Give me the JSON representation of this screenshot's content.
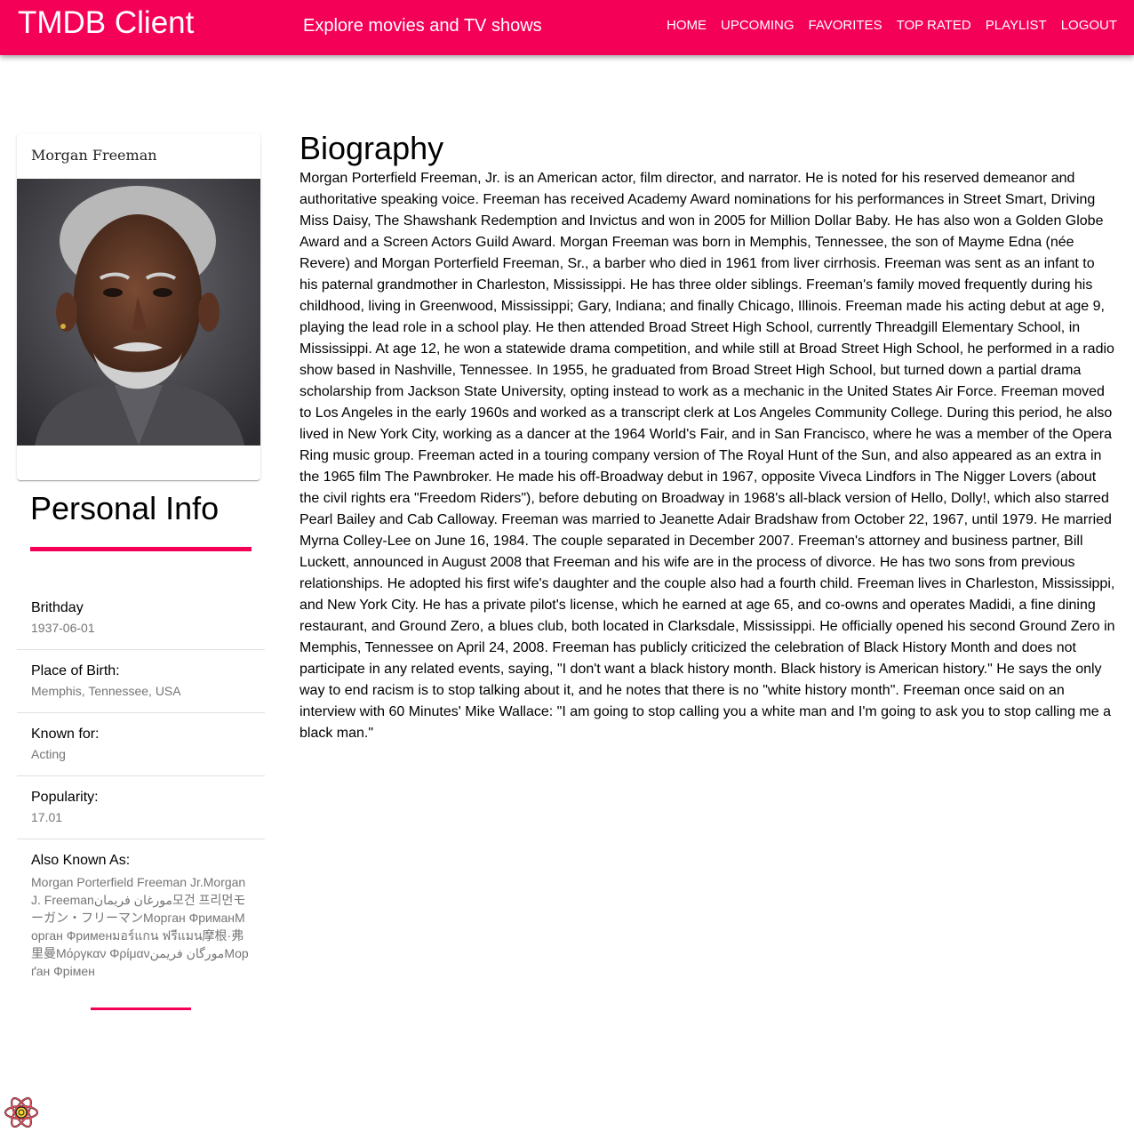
{
  "header": {
    "brand": "TMDB Client",
    "tagline": "Explore movies and TV shows",
    "nav": [
      "HOME",
      "UPCOMING",
      "FAVORITES",
      "TOP RATED",
      "PLAYLIST",
      "LOGOUT"
    ]
  },
  "person": {
    "name": "Morgan Freeman"
  },
  "personal_info": {
    "title": "Personal Info",
    "birthday_label": "Brithday",
    "birthday": "1937-06-01",
    "place_label": "Place of Birth:",
    "place": "Memphis, Tennessee, USA",
    "known_for_label": "Known for:",
    "known_for": "Acting",
    "popularity_label": "Popularity:",
    "popularity": "17.01",
    "aka_label": "Also Known As:",
    "aka": "Morgan Porterfield Freeman Jr.Morgan J. Freemanمورغان فريمان모건 프리먼モーガン・フリーマンМорган ФриманМорган Фрименมอร์แกน ฟรีแมน摩根·弗里曼Μόργκαν Φρίμανمورگان فریمنМорґан Фрімен"
  },
  "biography": {
    "title": "Biography",
    "text": "Morgan Porterfield Freeman, Jr. is an American actor, film director, and narrator. He is noted for his reserved demeanor and authoritative speaking voice. Freeman has received Academy Award nominations for his performances in Street Smart, Driving Miss Daisy, The Shawshank Redemption and Invictus and won in 2005 for Million Dollar Baby. He has also won a Golden Globe Award and a Screen Actors Guild Award. Morgan Freeman was born in Memphis, Tennessee, the son of Mayme Edna (née Revere) and Morgan Porterfield Freeman, Sr., a barber who died in 1961 from liver cirrhosis. Freeman was sent as an infant to his paternal grandmother in Charleston, Mississippi. He has three older siblings. Freeman's family moved frequently during his childhood, living in Greenwood, Mississippi; Gary, Indiana; and finally Chicago, Illinois. Freeman made his acting debut at age 9, playing the lead role in a school play. He then attended Broad Street High School, currently Threadgill Elementary School, in Mississippi. At age 12, he won a statewide drama competition, and while still at Broad Street High School, he performed in a radio show based in Nashville, Tennessee. In 1955, he graduated from Broad Street High School, but turned down a partial drama scholarship from Jackson State University, opting instead to work as a mechanic in the United States Air Force. Freeman moved to Los Angeles in the early 1960s and worked as a transcript clerk at Los Angeles Community College. During this period, he also lived in New York City, working as a dancer at the 1964 World's Fair, and in San Francisco, where he was a member of the Opera Ring music group. Freeman acted in a touring company version of The Royal Hunt of the Sun, and also appeared as an extra in the 1965 film The Pawnbroker. He made his off-Broadway debut in 1967, opposite Viveca Lindfors in The Nigger Lovers (about the civil rights era \"Freedom Riders\"), before debuting on Broadway in 1968's all-black version of Hello, Dolly!, which also starred Pearl Bailey and Cab Calloway. Freeman was married to Jeanette Adair Bradshaw from October 22, 1967, until 1979. He married Myrna Colley-Lee on June 16, 1984. The couple separated in December 2007. Freeman's attorney and business partner, Bill Luckett, announced in August 2008 that Freeman and his wife are in the process of divorce. He has two sons from previous relationships. He adopted his first wife's daughter and the couple also had a fourth child. Freeman lives in Charleston, Mississippi, and New York City. He has a private pilot's license, which he earned at age 65, and co-owns and operates Madidi, a fine dining restaurant, and Ground Zero, a blues club, both located in Clarksdale, Mississippi. He officially opened his second Ground Zero in Memphis, Tennessee on April 24, 2008. Freeman has publicly criticized the celebration of Black History Month and does not participate in any related events, saying, \"I don't want a black history month. Black history is American history.\" He says the only way to end racism is to stop talking about it, and he notes that there is no \"white history month\". Freeman once said on an interview with 60 Minutes' Mike Wallace: \"I am going to stop calling you a white man and I'm going to ask you to stop calling me a black man.\""
  },
  "icons": {
    "devtools": "react-icon"
  },
  "colors": {
    "accent": "#f50057",
    "muted_text": "#757575"
  }
}
